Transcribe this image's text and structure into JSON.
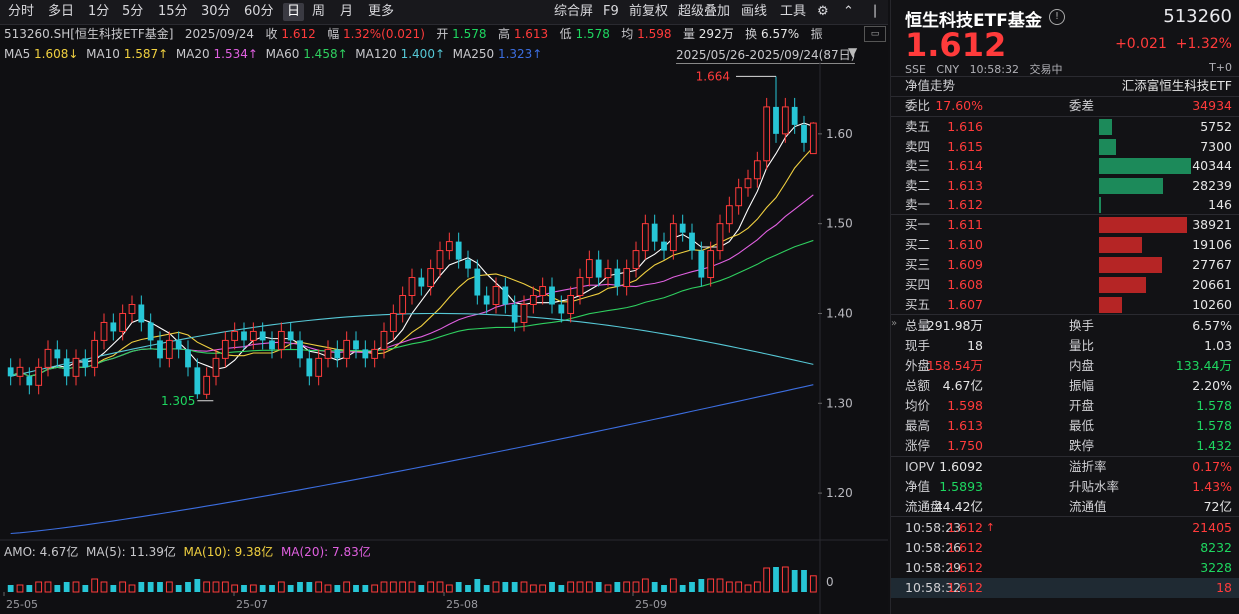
{
  "toolbar": {
    "items": [
      "分时",
      "多日",
      "1分",
      "5分",
      "15分",
      "30分",
      "60分",
      "日",
      "周",
      "月",
      "更多"
    ],
    "active": "日",
    "right_items": [
      "综合屏",
      "F9",
      "前复权",
      "超级叠加",
      "画线",
      "工具"
    ]
  },
  "info": {
    "symbol": "513260.SH[恒生科技ETF基金]",
    "date": "2025/09/24",
    "close_label": "收",
    "close": "1.612",
    "amp_label": "幅",
    "amp": "1.32%(0.021)",
    "open_label": "开",
    "open": "1.578",
    "high_label": "高",
    "high": "1.613",
    "low_label": "低",
    "low": "1.578",
    "avg_label": "均",
    "avg": "1.598",
    "vol_label": "量",
    "vol": "292万",
    "turn_label": "换",
    "turn": "6.57%",
    "more_label": "振"
  },
  "ma": {
    "ma5_label": "MA5",
    "ma5": "1.608↓",
    "ma10_label": "MA10",
    "ma10": "1.587↑",
    "ma20_label": "MA20",
    "ma20": "1.534↑",
    "ma60_label": "MA60",
    "ma60": "1.458↑",
    "ma120_label": "MA120",
    "ma120": "1.400↑",
    "ma250_label": "MA250",
    "ma250": "1.323↑",
    "range": "2025/05/26-2025/09/24(87日)"
  },
  "colors": {
    "up": "#ff3b3b",
    "down": "#27c6d6",
    "ma5": "#ffffff",
    "ma10": "#f0d040",
    "ma20": "#e060e0",
    "ma60": "#2fcf5f",
    "ma120": "#56c8d6",
    "ma250": "#3c6ee0"
  },
  "chart_data": {
    "type": "candlestick",
    "ylim": [
      1.15,
      1.68
    ],
    "yticks": [
      "1.60",
      "1.50",
      "1.40",
      "1.30",
      "1.20"
    ],
    "xticks": [
      "25-05",
      "25-07",
      "25-08",
      "25-09"
    ],
    "annotations": {
      "high": "1.664",
      "low": "1.305"
    },
    "candles": [
      [
        1.34,
        1.33,
        1.35,
        1.32
      ],
      [
        1.33,
        1.34,
        1.35,
        1.32
      ],
      [
        1.33,
        1.32,
        1.34,
        1.31
      ],
      [
        1.32,
        1.34,
        1.35,
        1.31
      ],
      [
        1.34,
        1.36,
        1.37,
        1.33
      ],
      [
        1.36,
        1.35,
        1.37,
        1.34
      ],
      [
        1.35,
        1.33,
        1.36,
        1.32
      ],
      [
        1.33,
        1.35,
        1.36,
        1.32
      ],
      [
        1.35,
        1.34,
        1.36,
        1.33
      ],
      [
        1.34,
        1.37,
        1.38,
        1.33
      ],
      [
        1.37,
        1.39,
        1.4,
        1.36
      ],
      [
        1.39,
        1.38,
        1.4,
        1.37
      ],
      [
        1.38,
        1.4,
        1.41,
        1.37
      ],
      [
        1.4,
        1.41,
        1.42,
        1.39
      ],
      [
        1.41,
        1.39,
        1.42,
        1.38
      ],
      [
        1.39,
        1.37,
        1.4,
        1.36
      ],
      [
        1.37,
        1.35,
        1.38,
        1.34
      ],
      [
        1.35,
        1.37,
        1.38,
        1.34
      ],
      [
        1.37,
        1.36,
        1.38,
        1.35
      ],
      [
        1.36,
        1.34,
        1.37,
        1.33
      ],
      [
        1.34,
        1.31,
        1.35,
        1.305
      ],
      [
        1.31,
        1.33,
        1.34,
        1.305
      ],
      [
        1.33,
        1.35,
        1.36,
        1.32
      ],
      [
        1.35,
        1.37,
        1.38,
        1.34
      ],
      [
        1.37,
        1.38,
        1.39,
        1.36
      ],
      [
        1.38,
        1.37,
        1.39,
        1.36
      ],
      [
        1.37,
        1.38,
        1.39,
        1.36
      ],
      [
        1.38,
        1.37,
        1.39,
        1.36
      ],
      [
        1.37,
        1.36,
        1.38,
        1.35
      ],
      [
        1.36,
        1.38,
        1.39,
        1.35
      ],
      [
        1.38,
        1.37,
        1.39,
        1.36
      ],
      [
        1.37,
        1.35,
        1.38,
        1.34
      ],
      [
        1.35,
        1.33,
        1.36,
        1.32
      ],
      [
        1.33,
        1.35,
        1.36,
        1.32
      ],
      [
        1.35,
        1.36,
        1.37,
        1.34
      ],
      [
        1.36,
        1.35,
        1.37,
        1.34
      ],
      [
        1.35,
        1.37,
        1.38,
        1.34
      ],
      [
        1.37,
        1.36,
        1.38,
        1.35
      ],
      [
        1.36,
        1.35,
        1.37,
        1.34
      ],
      [
        1.35,
        1.36,
        1.37,
        1.34
      ],
      [
        1.36,
        1.38,
        1.39,
        1.35
      ],
      [
        1.38,
        1.4,
        1.41,
        1.37
      ],
      [
        1.4,
        1.42,
        1.43,
        1.39
      ],
      [
        1.42,
        1.44,
        1.45,
        1.41
      ],
      [
        1.44,
        1.43,
        1.45,
        1.42
      ],
      [
        1.43,
        1.45,
        1.46,
        1.42
      ],
      [
        1.45,
        1.47,
        1.48,
        1.44
      ],
      [
        1.47,
        1.48,
        1.49,
        1.46
      ],
      [
        1.48,
        1.46,
        1.49,
        1.45
      ],
      [
        1.46,
        1.45,
        1.47,
        1.44
      ],
      [
        1.45,
        1.42,
        1.46,
        1.41
      ],
      [
        1.42,
        1.41,
        1.43,
        1.4
      ],
      [
        1.41,
        1.43,
        1.44,
        1.4
      ],
      [
        1.43,
        1.41,
        1.44,
        1.4
      ],
      [
        1.41,
        1.39,
        1.42,
        1.38
      ],
      [
        1.39,
        1.41,
        1.42,
        1.38
      ],
      [
        1.41,
        1.42,
        1.43,
        1.4
      ],
      [
        1.42,
        1.43,
        1.44,
        1.41
      ],
      [
        1.43,
        1.41,
        1.44,
        1.4
      ],
      [
        1.41,
        1.4,
        1.42,
        1.39
      ],
      [
        1.4,
        1.42,
        1.43,
        1.39
      ],
      [
        1.42,
        1.44,
        1.45,
        1.41
      ],
      [
        1.44,
        1.46,
        1.47,
        1.43
      ],
      [
        1.46,
        1.44,
        1.47,
        1.43
      ],
      [
        1.44,
        1.45,
        1.46,
        1.43
      ],
      [
        1.45,
        1.43,
        1.46,
        1.42
      ],
      [
        1.43,
        1.45,
        1.46,
        1.42
      ],
      [
        1.45,
        1.47,
        1.48,
        1.44
      ],
      [
        1.47,
        1.5,
        1.51,
        1.46
      ],
      [
        1.5,
        1.48,
        1.51,
        1.47
      ],
      [
        1.48,
        1.47,
        1.49,
        1.46
      ],
      [
        1.47,
        1.5,
        1.51,
        1.46
      ],
      [
        1.5,
        1.49,
        1.51,
        1.48
      ],
      [
        1.49,
        1.47,
        1.5,
        1.46
      ],
      [
        1.47,
        1.44,
        1.48,
        1.43
      ],
      [
        1.44,
        1.47,
        1.48,
        1.43
      ],
      [
        1.47,
        1.5,
        1.51,
        1.46
      ],
      [
        1.5,
        1.52,
        1.53,
        1.49
      ],
      [
        1.52,
        1.54,
        1.55,
        1.51
      ],
      [
        1.54,
        1.55,
        1.56,
        1.53
      ],
      [
        1.55,
        1.57,
        1.58,
        1.54
      ],
      [
        1.57,
        1.63,
        1.64,
        1.56
      ],
      [
        1.63,
        1.6,
        1.664,
        1.59
      ],
      [
        1.6,
        1.63,
        1.64,
        1.59
      ],
      [
        1.63,
        1.61,
        1.64,
        1.6
      ],
      [
        1.61,
        1.59,
        1.62,
        1.58
      ],
      [
        1.578,
        1.612,
        1.613,
        1.578
      ]
    ]
  },
  "amo": {
    "amo_label": "AMO:",
    "amo": "4.67亿",
    "ma5_label": "MA(5):",
    "ma5": "11.39亿",
    "ma10_label": "MA(10):",
    "ma10": "9.38亿",
    "ma20_label": "MA(20):",
    "ma20": "7.83亿",
    "zero": "0"
  },
  "right": {
    "title": "恒生科技ETF基金",
    "code": "513260",
    "price": "1.612",
    "change": "+0.021",
    "change_pct": "+1.32%",
    "meta": [
      "SSE",
      "CNY",
      "10:58:32",
      "交易中"
    ],
    "t0": "T+0",
    "nav_trend": "净值走势",
    "fund_company": "汇添富恒生科技ETF",
    "weibi_label": "委比",
    "weibi": "17.60%",
    "weicha_label": "委差",
    "weicha": "34934",
    "asks": [
      {
        "label": "卖五",
        "price": "1.616",
        "vol": "5752",
        "ratio": 0.14
      },
      {
        "label": "卖四",
        "price": "1.615",
        "vol": "7300",
        "ratio": 0.18
      },
      {
        "label": "卖三",
        "price": "1.614",
        "vol": "40344",
        "ratio": 1.0
      },
      {
        "label": "卖二",
        "price": "1.613",
        "vol": "28239",
        "ratio": 0.7
      },
      {
        "label": "卖一",
        "price": "1.612",
        "vol": "146",
        "ratio": 0.01
      }
    ],
    "bids": [
      {
        "label": "买一",
        "price": "1.611",
        "vol": "38921",
        "ratio": 0.96
      },
      {
        "label": "买二",
        "price": "1.610",
        "vol": "19106",
        "ratio": 0.47
      },
      {
        "label": "买三",
        "price": "1.609",
        "vol": "27767",
        "ratio": 0.69
      },
      {
        "label": "买四",
        "price": "1.608",
        "vol": "20661",
        "ratio": 0.51
      },
      {
        "label": "买五",
        "price": "1.607",
        "vol": "10260",
        "ratio": 0.25
      }
    ],
    "stats": [
      {
        "k1": "总量",
        "v1": "291.98万",
        "c1": "white",
        "k2": "换手",
        "v2": "6.57%",
        "c2": "white"
      },
      {
        "k1": "现手",
        "v1": "18",
        "c1": "white",
        "k2": "量比",
        "v2": "1.03",
        "c2": "white"
      },
      {
        "k1": "外盘",
        "v1": "158.54万",
        "c1": "red",
        "k2": "内盘",
        "v2": "133.44万",
        "c2": "green"
      },
      {
        "k1": "总额",
        "v1": "4.67亿",
        "c1": "white",
        "k2": "振幅",
        "v2": "2.20%",
        "c2": "white"
      },
      {
        "k1": "均价",
        "v1": "1.598",
        "c1": "red",
        "k2": "开盘",
        "v2": "1.578",
        "c2": "green"
      },
      {
        "k1": "最高",
        "v1": "1.613",
        "c1": "red",
        "k2": "最低",
        "v2": "1.578",
        "c2": "green"
      },
      {
        "k1": "涨停",
        "v1": "1.750",
        "c1": "red",
        "k2": "跌停",
        "v2": "1.432",
        "c2": "green"
      }
    ],
    "stats2": [
      {
        "k1": "IOPV",
        "v1": "1.6092",
        "c1": "white",
        "k2": "溢折率",
        "v2": "0.17%",
        "c2": "red"
      },
      {
        "k1": "净值",
        "v1": "1.5893",
        "c1": "green",
        "k2": "升贴水率",
        "v2": "1.43%",
        "c2": "red"
      },
      {
        "k1": "流通盘",
        "v1": "44.42亿",
        "c1": "white",
        "k2": "流通值",
        "v2": "72亿",
        "c2": "white"
      }
    ],
    "ticks": [
      {
        "time": "10:58:23",
        "price": "1.612",
        "arrow": "↑",
        "vol": "21405",
        "vc": "red"
      },
      {
        "time": "10:58:26",
        "price": "1.612",
        "arrow": "",
        "vol": "8232",
        "vc": "green"
      },
      {
        "time": "10:58:29",
        "price": "1.612",
        "arrow": "",
        "vol": "3228",
        "vc": "green"
      },
      {
        "time": "10:58:32",
        "price": "1.612",
        "arrow": "",
        "vol": "18",
        "vc": "red"
      }
    ]
  }
}
